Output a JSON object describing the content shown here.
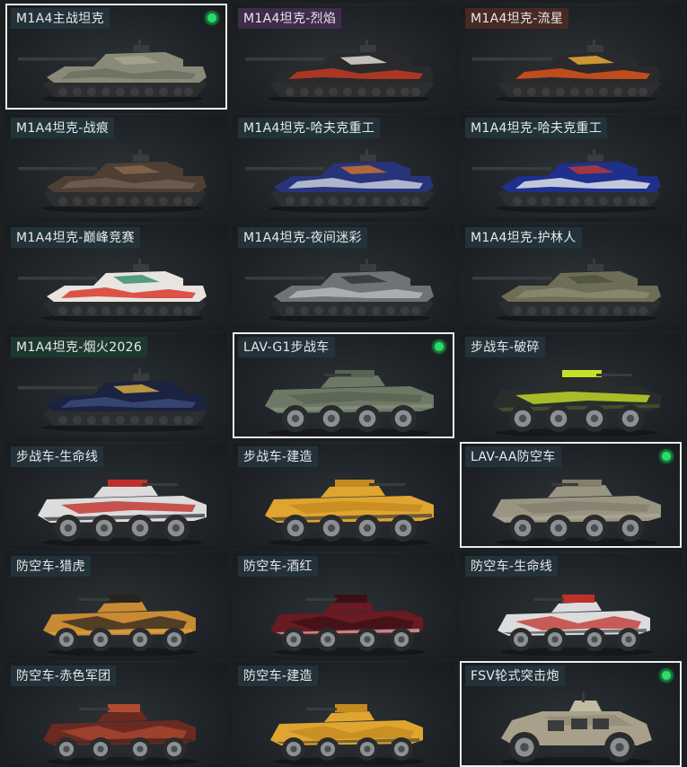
{
  "cards": [
    {
      "title": "M1A4主战坦克",
      "type": "tank",
      "selected": true,
      "equipped": true,
      "tag": "default",
      "colors": [
        "#8a8a78",
        "#6d6e60",
        "#a6a691"
      ]
    },
    {
      "title": "M1A4坦克-烈焰",
      "type": "tank",
      "selected": false,
      "equipped": false,
      "tag": "purple",
      "colors": [
        "#2a2a2c",
        "#c23a22",
        "#e8e6e0"
      ]
    },
    {
      "title": "M1A4坦克-流星",
      "type": "tank",
      "selected": false,
      "equipped": false,
      "tag": "red",
      "colors": [
        "#2a2a2c",
        "#d9541a",
        "#f2b13a"
      ]
    },
    {
      "title": "M1A4坦克-战痕",
      "type": "tank",
      "selected": false,
      "equipped": false,
      "tag": "default",
      "colors": [
        "#4e3f35",
        "#6e6050",
        "#8a6b4e"
      ]
    },
    {
      "title": "M1A4坦克-哈夫克重工",
      "type": "tank",
      "selected": false,
      "equipped": false,
      "tag": "default",
      "colors": [
        "#27347a",
        "#c7cedc",
        "#d4742a"
      ]
    },
    {
      "title": "M1A4坦克-哈夫克重工",
      "type": "tank",
      "selected": false,
      "equipped": false,
      "tag": "default",
      "colors": [
        "#1f2f8c",
        "#dfe3ea",
        "#c23a30"
      ]
    },
    {
      "title": "M1A4坦克-巅峰竞赛",
      "type": "tank",
      "selected": false,
      "equipped": false,
      "tag": "default",
      "colors": [
        "#e8e4e0",
        "#d8382c",
        "#2e8a6a"
      ]
    },
    {
      "title": "M1A4坦克-夜间迷彩",
      "type": "tank",
      "selected": false,
      "equipped": false,
      "tag": "default",
      "colors": [
        "#6e7378",
        "#b3b8bc",
        "#2e3236"
      ]
    },
    {
      "title": "M1A4坦克-护林人",
      "type": "tank",
      "selected": false,
      "equipped": false,
      "tag": "default",
      "colors": [
        "#6e6e58",
        "#8c8a6e",
        "#4e5040"
      ]
    },
    {
      "title": "M1A4坦克-烟火2026",
      "type": "tank",
      "selected": false,
      "equipped": false,
      "tag": "green",
      "colors": [
        "#1a2340",
        "#3d4a7a",
        "#e0b040"
      ]
    },
    {
      "title": "LAV-G1步战车",
      "type": "ifv",
      "selected": true,
      "equipped": true,
      "tag": "default",
      "colors": [
        "#6d7866",
        "#586353",
        "#8a9480"
      ]
    },
    {
      "title": "步战车-破碎",
      "type": "ifv",
      "selected": false,
      "equipped": false,
      "tag": "default",
      "colors": [
        "#2a2d2c",
        "#c8e02a",
        "#4a5a30"
      ]
    },
    {
      "title": "步战车-生命线",
      "type": "ifv",
      "selected": false,
      "equipped": false,
      "tag": "default",
      "colors": [
        "#dcdcdc",
        "#c0302a",
        "#2a2a2e"
      ]
    },
    {
      "title": "步战车-建造",
      "type": "ifv",
      "selected": false,
      "equipped": false,
      "tag": "default",
      "colors": [
        "#e0a530",
        "#c48a20",
        "#3a3a3a"
      ]
    },
    {
      "title": "LAV-AA防空车",
      "type": "ifv",
      "selected": true,
      "equipped": true,
      "tag": "default",
      "colors": [
        "#9a9482",
        "#837e6c",
        "#b0aa98"
      ]
    },
    {
      "title": "防空车-猎虎",
      "type": "aa",
      "selected": false,
      "equipped": false,
      "tag": "default",
      "colors": [
        "#c88a32",
        "#2a2420",
        "#e0a848"
      ]
    },
    {
      "title": "防空车-酒红",
      "type": "aa",
      "selected": false,
      "equipped": false,
      "tag": "default",
      "colors": [
        "#6a1a22",
        "#3a1014",
        "#dcdcdc"
      ]
    },
    {
      "title": "防空车-生命线",
      "type": "aa",
      "selected": false,
      "equipped": false,
      "tag": "default",
      "colors": [
        "#dcdcdc",
        "#c0302a",
        "#2a2a2e"
      ]
    },
    {
      "title": "防空车-赤色军团",
      "type": "aa",
      "selected": false,
      "equipped": false,
      "tag": "default",
      "colors": [
        "#6a2a22",
        "#b04a30",
        "#3a2a26"
      ]
    },
    {
      "title": "防空车-建造",
      "type": "aa",
      "selected": false,
      "equipped": false,
      "tag": "default",
      "colors": [
        "#e0a530",
        "#c48a20",
        "#3a3a3a"
      ]
    },
    {
      "title": "FSV轮式突击炮",
      "type": "fsv",
      "selected": true,
      "equipped": true,
      "tag": "default",
      "colors": [
        "#a8a08a",
        "#8e8772",
        "#c2bba4"
      ]
    }
  ],
  "ui": {
    "background": "#1c1f22",
    "equipped_indicator_color": "#2bdc6b",
    "selected_border_color": "#e9ecee"
  }
}
